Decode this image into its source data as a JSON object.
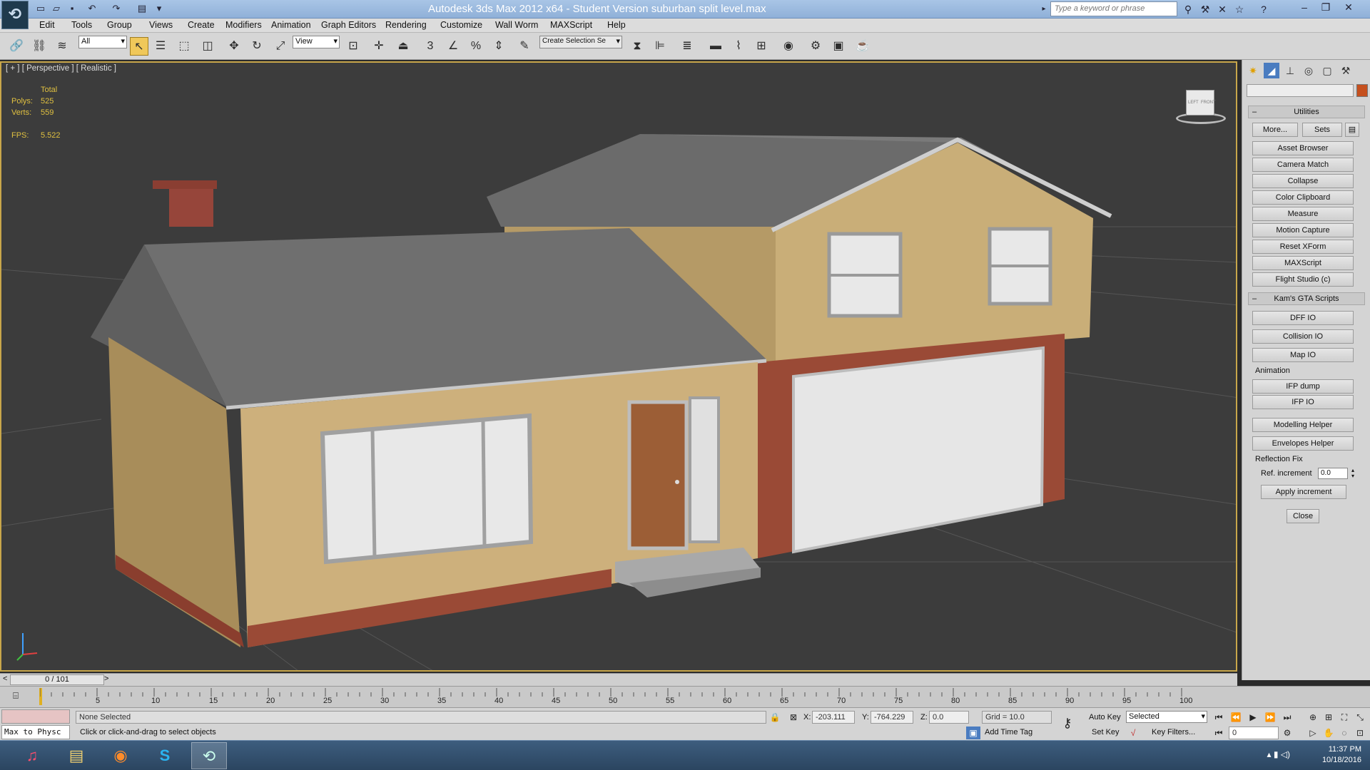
{
  "title_bar": {
    "title": "Autodesk 3ds Max  2012 x64  - Student Version   suburban split level.max",
    "search_placeholder": "Type a keyword or phrase"
  },
  "menu": [
    "Edit",
    "Tools",
    "Group",
    "Views",
    "Create",
    "Modifiers",
    "Animation",
    "Graph Editors",
    "Rendering",
    "Customize",
    "Wall Worm",
    "MAXScript",
    "Help"
  ],
  "toolbar": {
    "selection_filter": "All",
    "reference_coord": "View",
    "named_selection": "Create Selection Se",
    "snap_labels": [
      "3",
      "%"
    ]
  },
  "viewport": {
    "label": "[ + ] [ Perspective ] [ Realistic ]",
    "stats": {
      "total_label": "Total",
      "polys_label": "Polys:",
      "polys_value": "525",
      "verts_label": "Verts:",
      "verts_value": "559",
      "fps_label": "FPS:",
      "fps_value": "5.522"
    },
    "viewcube_front": "FRONT",
    "viewcube_left": "LEFT"
  },
  "command_panel": {
    "utilities_title": "Utilities",
    "more_button": "More...",
    "sets_button": "Sets",
    "utility_buttons": [
      "Asset Browser",
      "Camera Match",
      "Collapse",
      "Color Clipboard",
      "Measure",
      "Motion Capture",
      "Reset XForm",
      "MAXScript",
      "Flight Studio (c)"
    ],
    "gta_title": "Kam's GTA Scripts",
    "gta_buttons": [
      "DFF IO",
      "Collision IO",
      "Map IO"
    ],
    "animation_label": "Animation",
    "animation_buttons": [
      "IFP dump",
      "IFP IO"
    ],
    "helper_buttons": [
      "Modelling Helper",
      "Envelopes Helper"
    ],
    "reflection_label": "Reflection Fix",
    "ref_increment_label": "Ref. increment",
    "ref_increment_value": "0.0",
    "apply_button": "Apply increment",
    "close_button": "Close"
  },
  "timeline": {
    "frame_counter": "0 / 101",
    "ticks": [
      "5",
      "10",
      "15",
      "20",
      "25",
      "30",
      "35",
      "40",
      "45",
      "50",
      "55",
      "60",
      "65",
      "70",
      "75",
      "80",
      "85",
      "90",
      "95",
      "100"
    ],
    "prev_label": "<",
    "next_label": ">"
  },
  "status": {
    "listener": "Max to Physc",
    "selection": "None Selected",
    "prompt": "Click or click-and-drag to select objects",
    "x_label": "X:",
    "x_value": "-203.111",
    "y_label": "Y:",
    "y_value": "-764.229",
    "z_label": "Z:",
    "z_value": "0.0",
    "grid": "Grid = 10.0",
    "add_time_tag": "Add Time Tag",
    "auto_key": "Auto Key",
    "set_key": "Set Key",
    "key_mode": "Selected",
    "key_filters": "Key Filters...",
    "current_frame": "0"
  },
  "taskbar": {
    "apps": [
      "itunes-icon",
      "explorer-icon",
      "firefox-icon",
      "skype-icon",
      "3dsmax-icon"
    ],
    "time": "11:37 PM",
    "date": "10/18/2016"
  },
  "colors": {
    "accent": "#f0c85a",
    "viewport_bg": "#3c3c3c",
    "stats_text": "#e0c040"
  }
}
